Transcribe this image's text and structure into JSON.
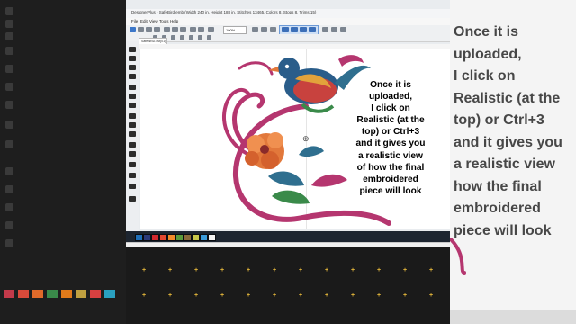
{
  "app": {
    "title": "DesignerPlus - SafeBird.emb (Width 240 in, Height 188 in, Stitches 13465, Colors 8, Stops 8, Trims 15)",
    "menu": [
      "File",
      "Edit",
      "View",
      "Tools",
      "Help"
    ],
    "zoom": "100%",
    "document_tab": "SafeBird2.dst(01)"
  },
  "caption": {
    "lines": [
      "Once it is",
      "uploaded,",
      "I click on",
      "Realistic (at the",
      "top) or Ctrl+3",
      "and it gives you",
      "a realistic view",
      "of how the final",
      "embroidered",
      "piece will look"
    ]
  },
  "background_caption": {
    "lines": [
      "Once it is",
      "uploaded,",
      "I click on",
      "Realistic (at the",
      "top) or Ctrl+3",
      "and it gives you",
      "a realistic view",
      "how the final",
      "embroidered",
      "piece will look"
    ]
  },
  "palette": [
    "#1f6fb8",
    "#2b3a7a",
    "#d0282e",
    "#e3472f",
    "#f18a2a",
    "#5a9a3a",
    "#8a6a3a",
    "#c7c74a",
    "#3a9ad9",
    "#f3f3f3"
  ],
  "background_palette": [
    "#c23a4a",
    "#d94a3a",
    "#e06a2a",
    "#3a8a4a",
    "#e07a1a",
    "#c0a040",
    "#d84040",
    "#2aa0c0"
  ],
  "colors": {
    "stem": "#b5366f",
    "bird_blue": "#2a5d8a",
    "bird_red": "#c8423e",
    "flower_orange": "#e2783b",
    "leaf_teal": "#2f6f8f",
    "stitch_mark": "#e2b53a"
  }
}
